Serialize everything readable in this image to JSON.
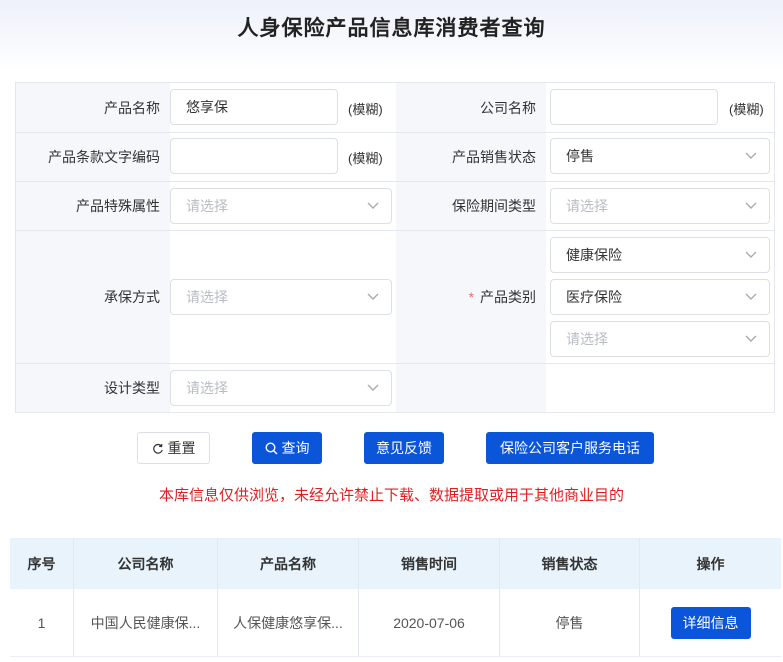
{
  "page_title": "人身保险产品信息库消费者查询",
  "form": {
    "product_name": {
      "label": "产品名称",
      "value": "悠享保",
      "hint": "(模糊)"
    },
    "company_name": {
      "label": "公司名称",
      "value": "",
      "hint": "(模糊)"
    },
    "clause_code": {
      "label": "产品条款文字编码",
      "value": "",
      "hint": "(模糊)"
    },
    "sales_status": {
      "label": "产品销售状态",
      "value": "停售"
    },
    "special_attr": {
      "label": "产品特殊属性",
      "placeholder": "请选择"
    },
    "period_type": {
      "label": "保险期间类型",
      "placeholder": "请选择"
    },
    "underwriting": {
      "label": "承保方式",
      "placeholder": "请选择"
    },
    "category": {
      "label": "产品类别",
      "required_mark": "*",
      "level1": "健康保险",
      "level2": "医疗保险",
      "level3_placeholder": "请选择"
    },
    "design_type": {
      "label": "设计类型",
      "placeholder": "请选择"
    }
  },
  "buttons": {
    "reset": "重置",
    "query": "查询",
    "feedback": "意见反馈",
    "hotline": "保险公司客户服务电话"
  },
  "notice": "本库信息仅供浏览，未经允许禁止下载、数据提取或用于其他商业目的",
  "table": {
    "headers": [
      "序号",
      "公司名称",
      "产品名称",
      "销售时间",
      "销售状态",
      "操作"
    ],
    "rows": [
      {
        "index": "1",
        "company": "中国人民健康保...",
        "product": "人保健康悠享保...",
        "sale_date": "2020-07-06",
        "status": "停售",
        "action": "详细信息"
      }
    ]
  },
  "colors": {
    "primary": "#0a55d8",
    "notice_red": "#e02020",
    "header_bg": "#e8f3fc"
  }
}
